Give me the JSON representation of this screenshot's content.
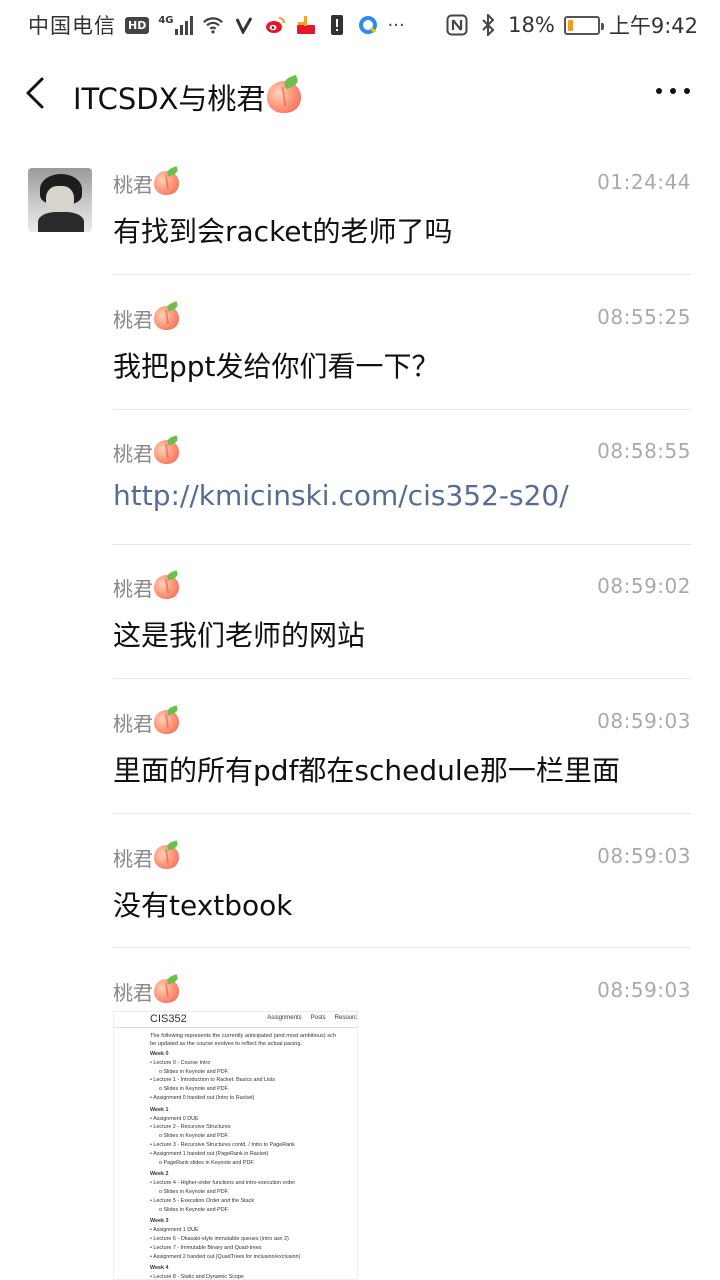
{
  "status_bar": {
    "carrier": "中国电信",
    "hd_badge": "HD",
    "network": "4G",
    "battery_percent": "18%",
    "battery_level": 0.18,
    "time": "上午9:42",
    "icons": [
      "signal-icon",
      "wifi-icon",
      "app-v-icon",
      "weibo-icon",
      "app-store-icon",
      "alert-icon",
      "qq-browser-icon",
      "more-notifications-icon",
      "nfc-icon",
      "bluetooth-icon",
      "battery-icon"
    ]
  },
  "header": {
    "title": "ITCSDX与桃君",
    "title_emoji": "peach-icon",
    "back_icon": "back-arrow-icon",
    "more_icon": "more-icon"
  },
  "messages": [
    {
      "sender": "桃君",
      "time": "01:24:44",
      "text": "有找到会racket的老师了吗",
      "type": "text"
    },
    {
      "sender": "桃君",
      "time": "08:55:25",
      "text": "我把ppt发给你们看一下？",
      "type": "text"
    },
    {
      "sender": "桃君",
      "time": "08:58:55",
      "text": "http://kmicinski.com/cis352-s20/",
      "type": "link"
    },
    {
      "sender": "桃君",
      "time": "08:59:02",
      "text": "这是我们老师的网站",
      "type": "text"
    },
    {
      "sender": "桃君",
      "time": "08:59:03",
      "text": "里面的所有pdf都在schedule那一栏里面",
      "type": "text"
    },
    {
      "sender": "桃君",
      "time": "08:59:03",
      "text": "没有textbook",
      "type": "text"
    },
    {
      "sender": "桃君",
      "time": "08:59:03",
      "type": "image"
    }
  ],
  "image_preview": {
    "brand": "CIS352",
    "nav": [
      "Assignments",
      "Posts",
      "Resourc"
    ],
    "intro": [
      "The following represents the currently anticipated (and most ambitious) sch",
      "be updated as the course evolves to reflect the actual pacing."
    ],
    "lines": [
      {
        "level": 0,
        "text": "Week 0"
      },
      {
        "level": 1,
        "text": "Lecture 0 - Course Intro"
      },
      {
        "level": 2,
        "text": "Slides in Keynote and PDF."
      },
      {
        "level": 1,
        "text": "Lecture 1 - Introduction to Racket: Basics and Lists"
      },
      {
        "level": 2,
        "text": "Slides in Keynote and PDF."
      },
      {
        "level": 1,
        "text": "Assignment 0 handed out (Intro to Racket)"
      },
      {
        "level": 0,
        "text": "Week 1"
      },
      {
        "level": 1,
        "text": "Assignment 0 DUE"
      },
      {
        "level": 1,
        "text": "Lecture 2 - Recursive Structures"
      },
      {
        "level": 2,
        "text": "Slides in Keynote and PDF."
      },
      {
        "level": 1,
        "text": "Lecture 3 - Recursive Structures contd. / Intro to PageRank"
      },
      {
        "level": 1,
        "text": "Assignment 1 handed out (PageRank in Racket)"
      },
      {
        "level": 2,
        "text": "PageRank slides in Keynote and PDF."
      },
      {
        "level": 0,
        "text": "Week 2"
      },
      {
        "level": 1,
        "text": "Lecture 4 - Higher-order functions and intro execution order"
      },
      {
        "level": 2,
        "text": "Slides in Keynote and PDF."
      },
      {
        "level": 1,
        "text": "Lecture 5 - Execution Order and the Stack"
      },
      {
        "level": 2,
        "text": "Slides in Keynote and PDF."
      },
      {
        "level": 0,
        "text": "Week 3"
      },
      {
        "level": 1,
        "text": "Assignment 1 DUE"
      },
      {
        "level": 1,
        "text": "Lecture 6 - Okasaki-style immutable queues (intro asn 2)"
      },
      {
        "level": 1,
        "text": "Lecture 7 - Immutable Binary and Quad-trees"
      },
      {
        "level": 1,
        "text": "Assignment 2 handed out (QuadTrees for inclusion/exclusion)"
      },
      {
        "level": 0,
        "text": "Week 4"
      },
      {
        "level": 1,
        "text": "Lecture 8 - Static and Dynamic Scope"
      }
    ]
  }
}
